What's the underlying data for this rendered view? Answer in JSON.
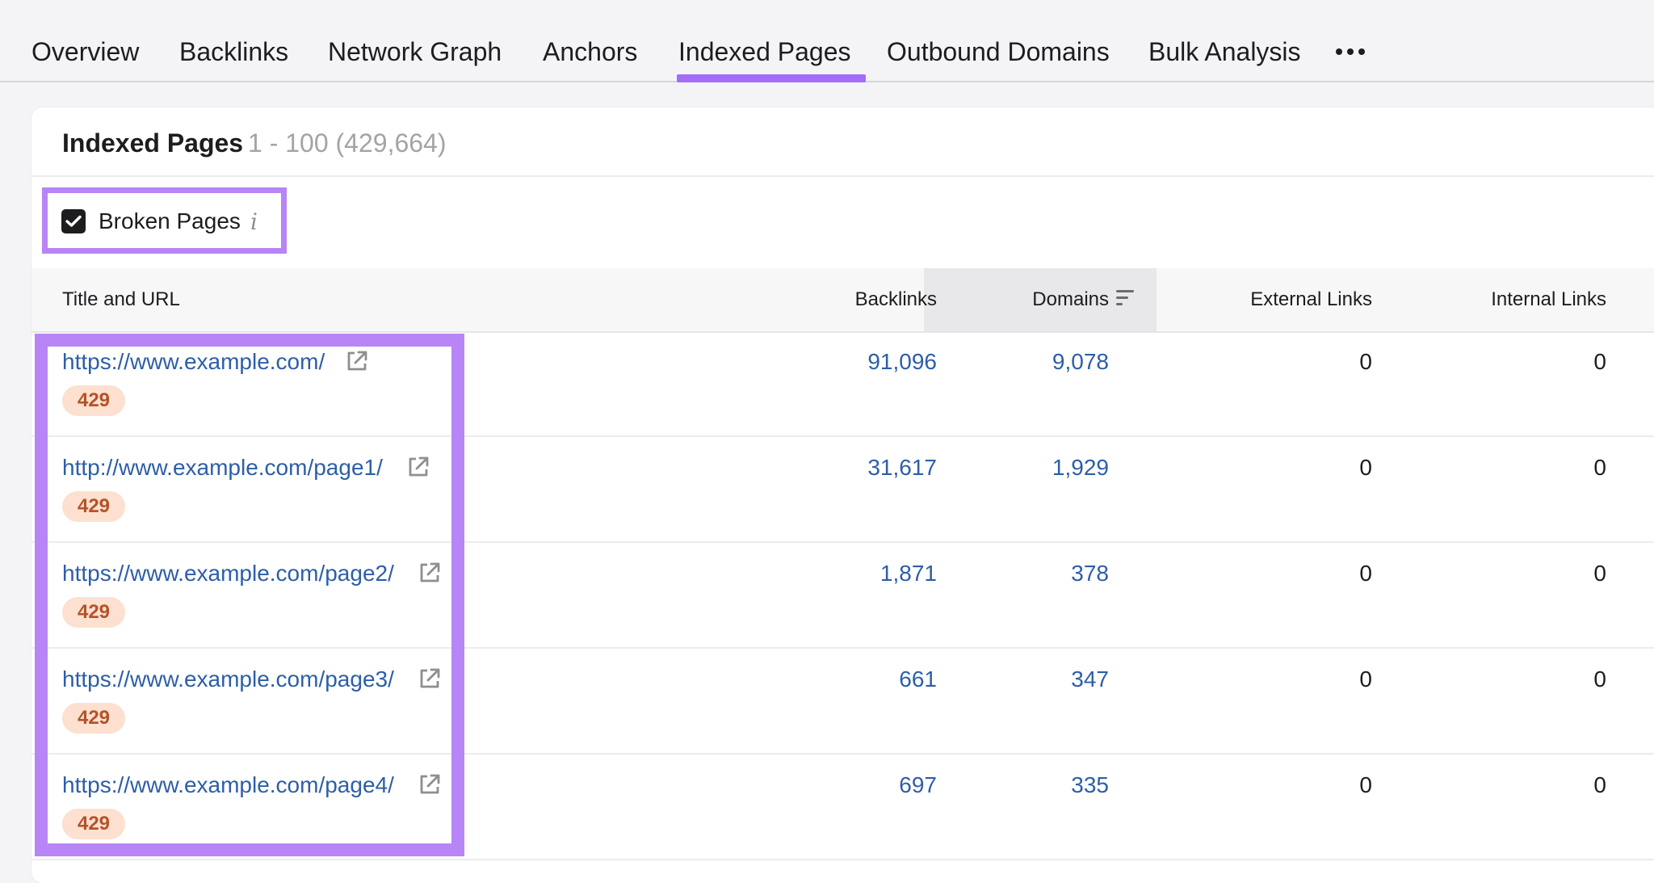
{
  "tabs": [
    {
      "label": "Overview",
      "active": false
    },
    {
      "label": "Backlinks",
      "active": false
    },
    {
      "label": "Network Graph",
      "active": false
    },
    {
      "label": "Anchors",
      "active": false
    },
    {
      "label": "Indexed Pages",
      "active": true
    },
    {
      "label": "Outbound Domains",
      "active": false
    },
    {
      "label": "Bulk Analysis",
      "active": false
    }
  ],
  "tabs_more_icon": "more-horizontal-icon",
  "card": {
    "title": "Indexed Pages",
    "range": "1 - 100 (429,664)"
  },
  "filter": {
    "label": "Broken Pages",
    "checked": true,
    "info_icon": "i"
  },
  "columns": {
    "title_url": "Title and URL",
    "backlinks": "Backlinks",
    "domains": "Domains",
    "external_links": "External Links",
    "internal_links": "Internal Links"
  },
  "rows": [
    {
      "url": "https://www.example.com/",
      "status": "429",
      "backlinks": "91,096",
      "domains": "9,078",
      "external": "0",
      "internal": "0"
    },
    {
      "url": "http://www.example.com/page1/",
      "status": "429",
      "backlinks": "31,617",
      "domains": "1,929",
      "external": "0",
      "internal": "0"
    },
    {
      "url": "https://www.example.com/page2/",
      "status": "429",
      "backlinks": "1,871",
      "domains": "378",
      "external": "0",
      "internal": "0"
    },
    {
      "url": "https://www.example.com/page3/",
      "status": "429",
      "backlinks": "661",
      "domains": "347",
      "external": "0",
      "internal": "0"
    },
    {
      "url": "https://www.example.com/page4/",
      "status": "429",
      "backlinks": "697",
      "domains": "335",
      "external": "0",
      "internal": "0"
    }
  ],
  "colors": {
    "accent_highlight": "#b785f5",
    "link": "#2d5ea8",
    "badge_bg": "#fde0cf",
    "badge_text": "#b4532a"
  }
}
